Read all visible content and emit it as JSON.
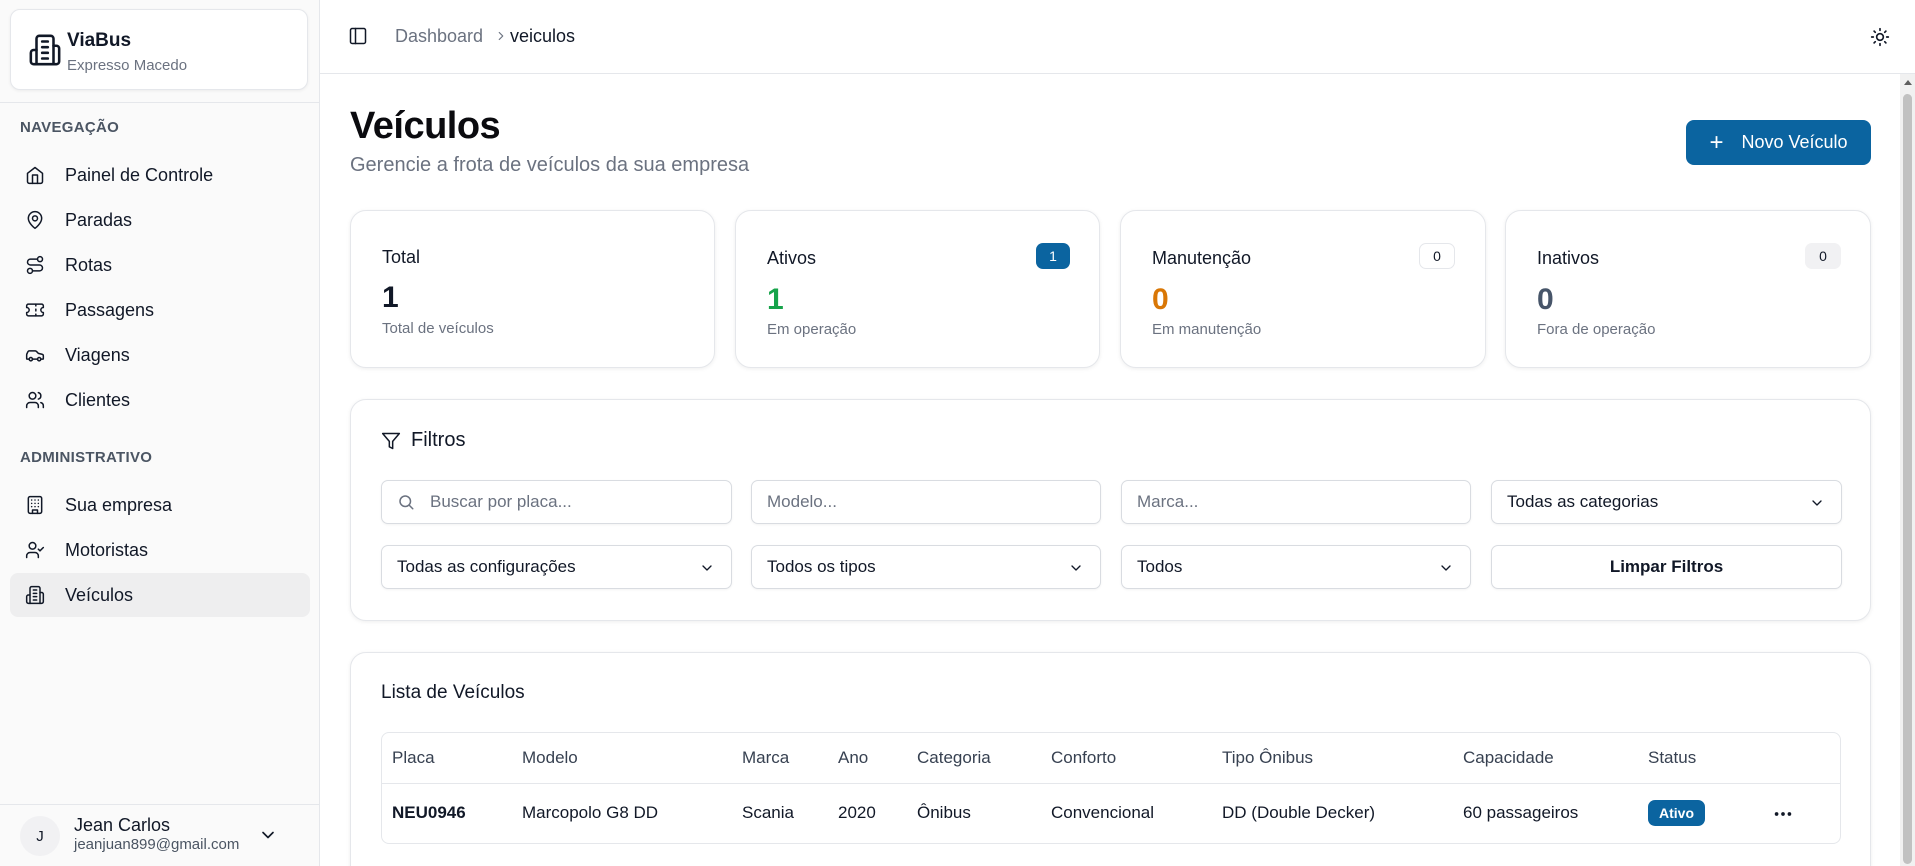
{
  "brand": {
    "title": "ViaBus",
    "subtitle": "Expresso Macedo"
  },
  "sidebar": {
    "section_nav": "NAVEGAÇÃO",
    "nav_items": [
      {
        "label": "Painel de Controle",
        "icon": "home-icon"
      },
      {
        "label": "Paradas",
        "icon": "map-pin-icon"
      },
      {
        "label": "Rotas",
        "icon": "route-icon"
      },
      {
        "label": "Passagens",
        "icon": "ticket-icon"
      },
      {
        "label": "Viagens",
        "icon": "car-icon"
      },
      {
        "label": "Clientes",
        "icon": "users-icon"
      }
    ],
    "section_admin": "ADMINISTRATIVO",
    "admin_items": [
      {
        "label": "Sua empresa",
        "icon": "building-icon"
      },
      {
        "label": "Motoristas",
        "icon": "user-check-icon"
      },
      {
        "label": "Veículos",
        "icon": "bus-icon",
        "active": true
      }
    ]
  },
  "user": {
    "initial": "J",
    "name": "Jean Carlos",
    "email": "jeanjuan899@gmail.com"
  },
  "header": {
    "breadcrumb_root": "Dashboard",
    "breadcrumb_current": "veiculos"
  },
  "page": {
    "title": "Veículos",
    "subtitle": "Gerencie a frota de veículos da sua empresa",
    "new_button": "Novo Veículo"
  },
  "stats": [
    {
      "label": "Total",
      "value": "1",
      "desc": "Total de veículos",
      "color": "#111827"
    },
    {
      "label": "Ativos",
      "value": "1",
      "desc": "Em operação",
      "badge": "1",
      "color": "#16a34a",
      "badge_color": "#0b64a0"
    },
    {
      "label": "Manutenção",
      "value": "0",
      "desc": "Em manutenção",
      "badge": "0",
      "color": "#d97706"
    },
    {
      "label": "Inativos",
      "value": "0",
      "desc": "Fora de operação",
      "badge": "0",
      "color": "#475569"
    }
  ],
  "filters": {
    "title": "Filtros",
    "search_placeholder": "Buscar por placa...",
    "model_placeholder": "Modelo...",
    "brand_placeholder": "Marca...",
    "category_select": "Todas as categorias",
    "config_select": "Todas as configurações",
    "type_select": "Todos os tipos",
    "status_select": "Todos",
    "clear_button": "Limpar Filtros"
  },
  "vehicle_list": {
    "title": "Lista de Veículos",
    "columns": [
      "Placa",
      "Modelo",
      "Marca",
      "Ano",
      "Categoria",
      "Conforto",
      "Tipo Ônibus",
      "Capacidade",
      "Status"
    ],
    "rows": [
      {
        "placa": "NEU0946",
        "modelo": "Marcopolo G8 DD",
        "marca": "Scania",
        "ano": "2020",
        "categoria": "Ônibus",
        "conforto": "Convencional",
        "tipo": "DD (Double Decker)",
        "capacidade": "60 passageiros",
        "status": "Ativo"
      }
    ]
  },
  "colors": {
    "primary": "#0b64a0",
    "success": "#16a34a",
    "warning": "#d97706"
  }
}
